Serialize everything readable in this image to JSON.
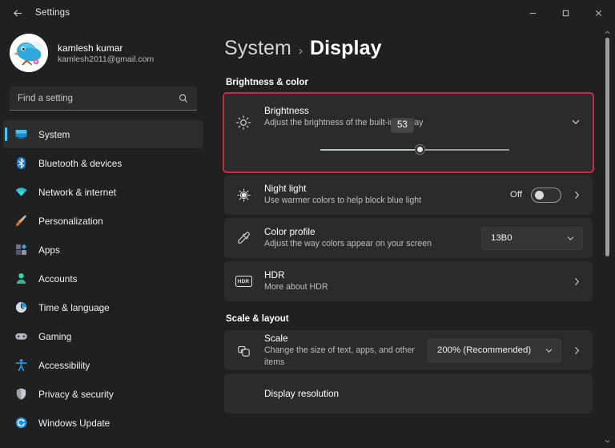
{
  "titlebar": {
    "back_label": "Back",
    "title": "Settings",
    "minimize_label": "Minimize",
    "maximize_label": "Maximize",
    "close_label": "Close"
  },
  "account": {
    "name": "kamlesh kumar",
    "email": "kamlesh2011@gmail.com",
    "avatar_icon": "bird-avatar"
  },
  "search": {
    "placeholder": "Find a setting",
    "value": "",
    "icon": "search-icon"
  },
  "sidebar": {
    "items": [
      {
        "label": "System",
        "icon": "monitor-icon",
        "active": true
      },
      {
        "label": "Bluetooth & devices",
        "icon": "bluetooth-icon",
        "active": false
      },
      {
        "label": "Network & internet",
        "icon": "wifi-icon",
        "active": false
      },
      {
        "label": "Personalization",
        "icon": "paintbrush-icon",
        "active": false
      },
      {
        "label": "Apps",
        "icon": "apps-icon",
        "active": false
      },
      {
        "label": "Accounts",
        "icon": "person-icon",
        "active": false
      },
      {
        "label": "Time & language",
        "icon": "clock-icon",
        "active": false
      },
      {
        "label": "Gaming",
        "icon": "gamepad-icon",
        "active": false
      },
      {
        "label": "Accessibility",
        "icon": "accessibility-icon",
        "active": false
      },
      {
        "label": "Privacy & security",
        "icon": "shield-icon",
        "active": false
      },
      {
        "label": "Windows Update",
        "icon": "update-icon",
        "active": false
      }
    ]
  },
  "breadcrumb": {
    "root": "System",
    "separator": "›",
    "leaf": "Display"
  },
  "sections": {
    "brightness_color": {
      "heading": "Brightness & color",
      "brightness": {
        "title": "Brightness",
        "subtitle": "Adjust the brightness of the built-in display",
        "value": 53,
        "tooltip": "53",
        "icon": "brightness-sun-icon",
        "expand_icon": "chevron-down-icon",
        "highlighted": true,
        "highlight_color": "#bf2f47"
      },
      "night_light": {
        "title": "Night light",
        "subtitle": "Use warmer colors to help block blue light",
        "state_label": "Off",
        "state_on": false,
        "icon": "night-light-icon",
        "chevron_icon": "chevron-right-icon"
      },
      "color_profile": {
        "title": "Color profile",
        "subtitle": "Adjust the way colors appear on your screen",
        "selected": "13B0",
        "icon": "eyedropper-icon",
        "dropdown_icon": "chevron-down-icon"
      },
      "hdr": {
        "title": "HDR",
        "subtitle": "More about HDR",
        "icon": "hdr-badge-icon",
        "badge_text": "HDR",
        "chevron_icon": "chevron-right-icon"
      }
    },
    "scale_layout": {
      "heading": "Scale & layout",
      "scale": {
        "title": "Scale",
        "subtitle": "Change the size of text, apps, and other items",
        "selected": "200% (Recommended)",
        "icon": "scale-icon",
        "dropdown_icon": "chevron-down-icon",
        "chevron_icon": "chevron-right-icon"
      },
      "display_resolution": {
        "title": "Display resolution"
      }
    }
  },
  "scrollbar": {
    "up_icon": "chevron-up-icon",
    "down_icon": "chevron-down-icon",
    "thumb_position": "top"
  },
  "colors": {
    "accent": "#4cc2ff",
    "window_bg": "#202020",
    "card_bg": "#2b2b2b",
    "highlight": "#bf2f47"
  }
}
